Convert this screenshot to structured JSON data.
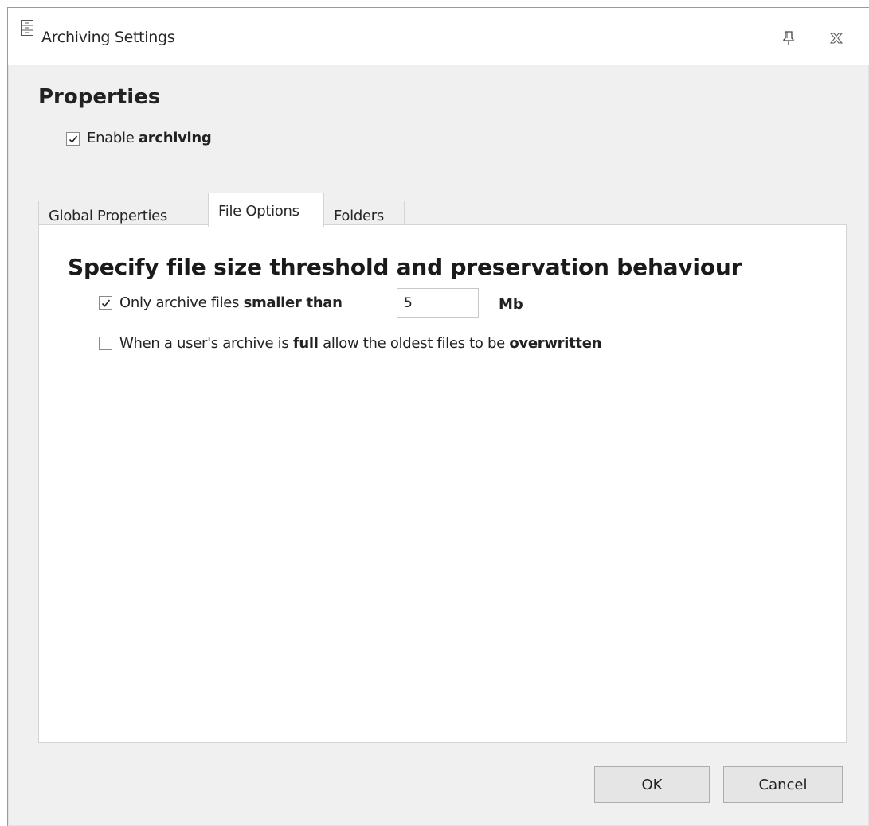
{
  "window": {
    "title": "Archiving Settings"
  },
  "properties": {
    "title": "Properties",
    "enable_label_prefix": "Enable ",
    "enable_label_bold": "archiving",
    "enable_checked": true
  },
  "tabs": [
    {
      "label": "Global Properties",
      "active": false
    },
    {
      "label": "File Options",
      "active": true
    },
    {
      "label": "Folders",
      "active": false
    }
  ],
  "file_options": {
    "heading": "Specify file size threshold and preservation behaviour",
    "size_option": {
      "checked": true,
      "label_prefix": "Only archive files ",
      "label_bold": "smaller than",
      "value": "5",
      "unit": "Mb"
    },
    "overwrite_option": {
      "checked": false,
      "label_part1": "When a user's archive is ",
      "label_bold1": "full",
      "label_part2": " allow the oldest files to be ",
      "label_bold2": "overwritten"
    }
  },
  "buttons": {
    "ok": "OK",
    "cancel": "Cancel"
  },
  "icons": {
    "window": "cabinet-icon",
    "pin": "pin-icon",
    "close": "close-icon",
    "check": "checkmark-icon"
  },
  "colors": {
    "window_bg": "#f0f0f0",
    "panel_bg": "#ffffff",
    "border": "#d4d4d4",
    "button_bg": "#e5e5e5"
  }
}
